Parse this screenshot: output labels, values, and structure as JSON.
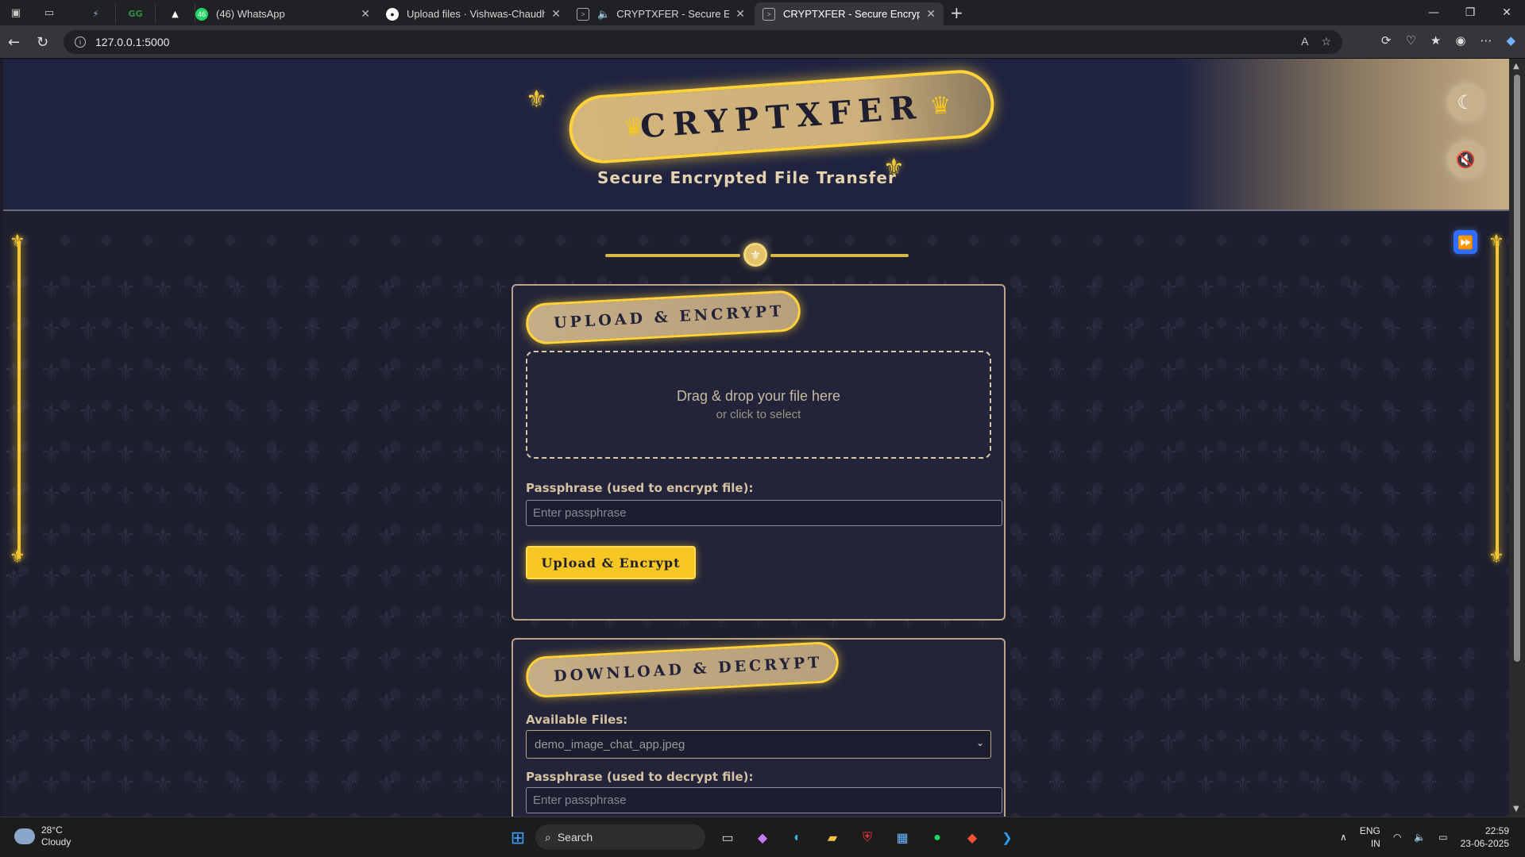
{
  "browser": {
    "tabs": [
      {
        "title": "(46) WhatsApp",
        "active": false
      },
      {
        "title": "Upload files · Vishwas-Chaudhary",
        "active": false
      },
      {
        "title": "CRYPTXFER - Secure Encrypted",
        "active": false
      },
      {
        "title": "CRYPTXFER - Secure Encrypted Fi",
        "active": true
      }
    ],
    "pinned": [
      "bolt",
      "geeks",
      "vercel"
    ],
    "whatsapp_badge": "46",
    "url": "127.0.0.1:5000"
  },
  "header": {
    "title": "CRYPTXFER",
    "subtitle": "Secure Encrypted File Transfer"
  },
  "controls": {
    "theme_toggle_icon": "moon-icon",
    "mute_icon": "muted-speaker-icon",
    "skip_icon": "fast-forward-icon"
  },
  "upload_card": {
    "heading": "UPLOAD & ENCRYPT",
    "drop_main": "Drag & drop your file here",
    "drop_sub": "or click to select",
    "passphrase_label": "Passphrase (used to encrypt file):",
    "passphrase_placeholder": "Enter passphrase",
    "button": "Upload & Encrypt"
  },
  "download_card": {
    "heading": "DOWNLOAD & DECRYPT",
    "files_label": "Available Files:",
    "selected_file": "demo_image_chat_app.jpeg",
    "passphrase_label": "Passphrase (used to decrypt file):",
    "passphrase_placeholder": "Enter passphrase"
  },
  "taskbar": {
    "weather_temp": "28°C",
    "weather_desc": "Cloudy",
    "search_placeholder": "Search",
    "lang_primary": "ENG",
    "lang_secondary": "IN",
    "time": "22:59",
    "date": "23-06-2025"
  },
  "colors": {
    "accent_gold": "#f6c722",
    "page_bg": "#1d1e2e",
    "header_bg": "#1f2340",
    "card_border": "#b9a58a"
  }
}
